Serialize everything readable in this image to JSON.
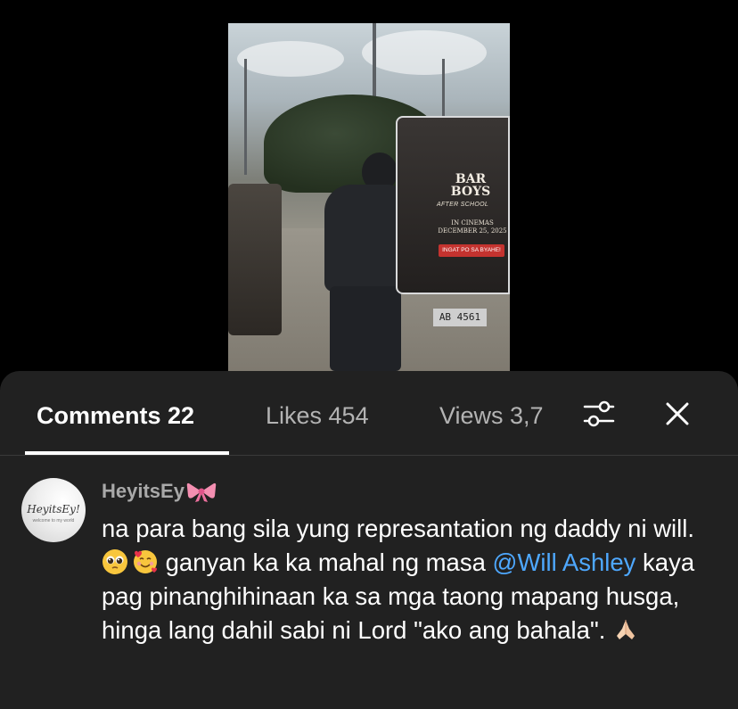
{
  "video": {
    "poster_title_line1": "BAR",
    "poster_title_line2": "BOYS",
    "poster_subtitle": "AFTER SCHOOL",
    "poster_date_line1": "IN CINEMAS",
    "poster_date_line2": "DECEMBER 25, 2025",
    "poster_tagline": "INGAT PO SA BYAHE!",
    "plate": "AB 4561"
  },
  "tabs": [
    {
      "label": "Comments 22",
      "active": true
    },
    {
      "label": "Likes 454",
      "active": false
    },
    {
      "label": "Views 3,7",
      "active": false
    }
  ],
  "icons": {
    "filter": "filter-sliders-icon",
    "close": "close-icon",
    "bow": "ribbon-bow-emoji",
    "pleading": "pleading-face-emoji",
    "hearts": "smiling-face-with-hearts-emoji",
    "pray": "folded-hands-emoji"
  },
  "colors": {
    "sheet_bg": "#212121",
    "mention": "#4ea8ff",
    "username": "#a9a9a9",
    "inactive_tab": "#b3b3b3"
  },
  "comment": {
    "avatar_text": "HeyitsEy!",
    "avatar_subtext": "welcome to my world",
    "username": "HeyitsEy",
    "text_1": "na para bang sila yung represantation ng daddy ni will.",
    "text_2": " ganyan ka ka mahal ng masa ",
    "mention": "@Will Ashley",
    "text_3": " kaya pag pinanghihinaan ka sa mga taong mapang husga, hinga lang dahil sabi ni Lord \"ako ang bahala\". "
  }
}
